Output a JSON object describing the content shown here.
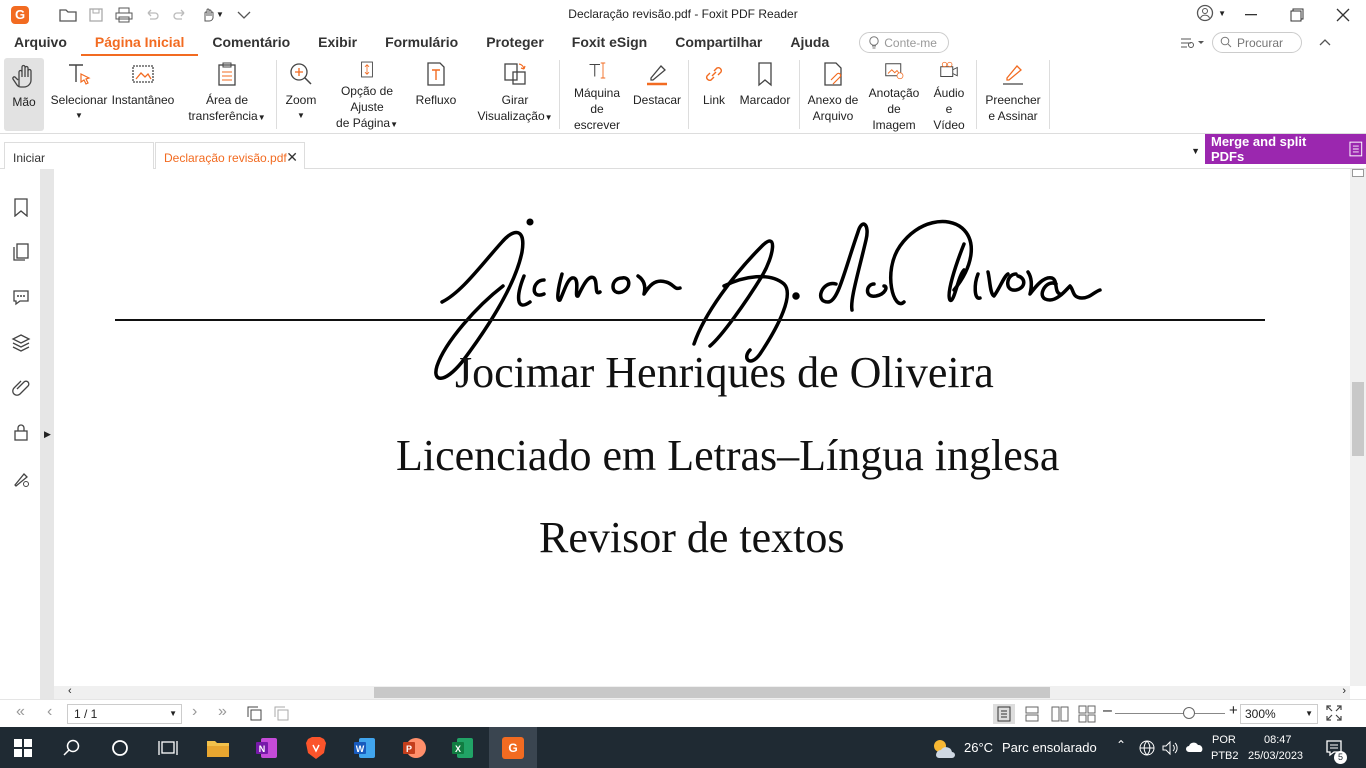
{
  "window": {
    "title": "Declaração revisão.pdf - Foxit PDF Reader"
  },
  "menu": {
    "items": [
      "Arquivo",
      "Página Inicial",
      "Comentário",
      "Exibir",
      "Formulário",
      "Proteger",
      "Foxit eSign",
      "Compartilhar",
      "Ajuda"
    ],
    "active": "Página Inicial",
    "tell_me_placeholder": "Conte-me",
    "search_placeholder": "Procurar"
  },
  "ribbon": {
    "mao": "Mão",
    "selecionar": "Selecionar",
    "instantaneo": "Instantâneo",
    "area_1": "Área de",
    "area_2": "transferência",
    "zoom": "Zoom",
    "opcao_1": "Opção de Ajuste",
    "opcao_2": "de Página",
    "refluxo": "Refluxo",
    "girar_1": "Girar",
    "girar_2": "Visualização",
    "maquina_1": "Máquina",
    "maquina_2": "de escrever",
    "destacar": "Destacar",
    "link": "Link",
    "marcador": "Marcador",
    "anexo_1": "Anexo de",
    "anexo_2": "Arquivo",
    "anotacao_1": "Anotação",
    "anotacao_2": "de Imagem",
    "audio_1": "Áudio",
    "audio_2": "e Vídeo",
    "preencher_1": "Preencher",
    "preencher_2": "e Assinar"
  },
  "tabs": {
    "home": "Iniciar",
    "document": "Declaração revisão.pdf",
    "promo": "Merge and split PDFs"
  },
  "document": {
    "name": "Jocimar Henriques de Oliveira",
    "degree": "Licenciado em Letras–Língua inglesa",
    "role": "Revisor de textos"
  },
  "status": {
    "page": "1 / 1",
    "zoom": "300%"
  },
  "taskbar": {
    "weather_temp": "26°C",
    "weather_desc": "Parc ensolarado",
    "lang_1": "POR",
    "lang_2": "PTB2",
    "time": "08:47",
    "date": "25/03/2023",
    "notifications": "5"
  },
  "colors": {
    "accent": "#f26b21",
    "promo": "#9b27af",
    "taskbar": "#1f2a33"
  }
}
